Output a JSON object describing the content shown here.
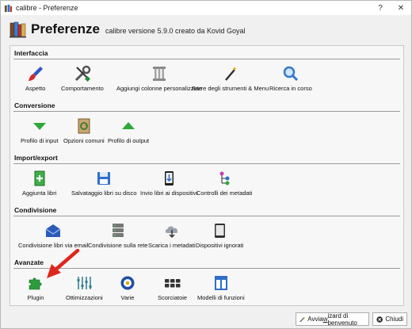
{
  "window": {
    "title": "calibre - Preferenze",
    "help_glyph": "?",
    "close_glyph": "✕"
  },
  "header": {
    "title": "Preferenze",
    "subtitle": "calibre versione 5.9.0 creato da Kovid Goyal"
  },
  "sections": [
    {
      "title": "Interfaccia",
      "items": [
        {
          "label": "Aspetto",
          "icon": "paintbrush-icon"
        },
        {
          "label": "Comportamento",
          "icon": "tools-icon"
        },
        {
          "label": "Aggiungi colonne personalizzate",
          "icon": "column-icon"
        },
        {
          "label": "Barre degli strumenti & Menu",
          "icon": "magic-wand-icon"
        },
        {
          "label": "Ricerca in corso",
          "icon": "search-icon"
        }
      ]
    },
    {
      "title": "Conversione",
      "items": [
        {
          "label": "Profilo di input",
          "icon": "arrow-down-icon"
        },
        {
          "label": "Opzioni comuni",
          "icon": "book-convert-icon"
        },
        {
          "label": "Profilo di output",
          "icon": "arrow-up-icon"
        }
      ]
    },
    {
      "title": "Import/export",
      "items": [
        {
          "label": "Aggiunta libri",
          "icon": "add-book-icon"
        },
        {
          "label": "Salvataggio libri su disco",
          "icon": "floppy-disk-icon"
        },
        {
          "label": "Invio libri ai dispositivi",
          "icon": "device-send-icon"
        },
        {
          "label": "Controlli dei metadati",
          "icon": "metadata-tree-icon"
        }
      ]
    },
    {
      "title": "Condivisione",
      "items": [
        {
          "label": "Condivisione libri via email",
          "icon": "email-icon"
        },
        {
          "label": "Condivisione sulla rete",
          "icon": "server-icon"
        },
        {
          "label": "Scarica i metadati",
          "icon": "cloud-download-icon"
        },
        {
          "label": "Dispositivi ignorati",
          "icon": "tablet-icon"
        }
      ]
    },
    {
      "title": "Avanzate",
      "items": [
        {
          "label": "Plugin",
          "icon": "puzzle-icon"
        },
        {
          "label": "Ottimizzazioni",
          "icon": "sliders-icon"
        },
        {
          "label": "Varie",
          "icon": "gear-icon"
        },
        {
          "label": "Scorciatoie",
          "icon": "keyboard-icon"
        },
        {
          "label": "Modelli di funzioni",
          "icon": "template-icon"
        }
      ]
    }
  ],
  "buttons": {
    "wizard_pre": "Avvia ",
    "wizard_underlined": "w",
    "wizard_post": "izard di benvenuto",
    "close_label": "Chiudi"
  },
  "colors": {
    "annotation_arrow": "#e0261c",
    "accent_blue": "#2f6fc9",
    "green": "#2fa83a"
  }
}
